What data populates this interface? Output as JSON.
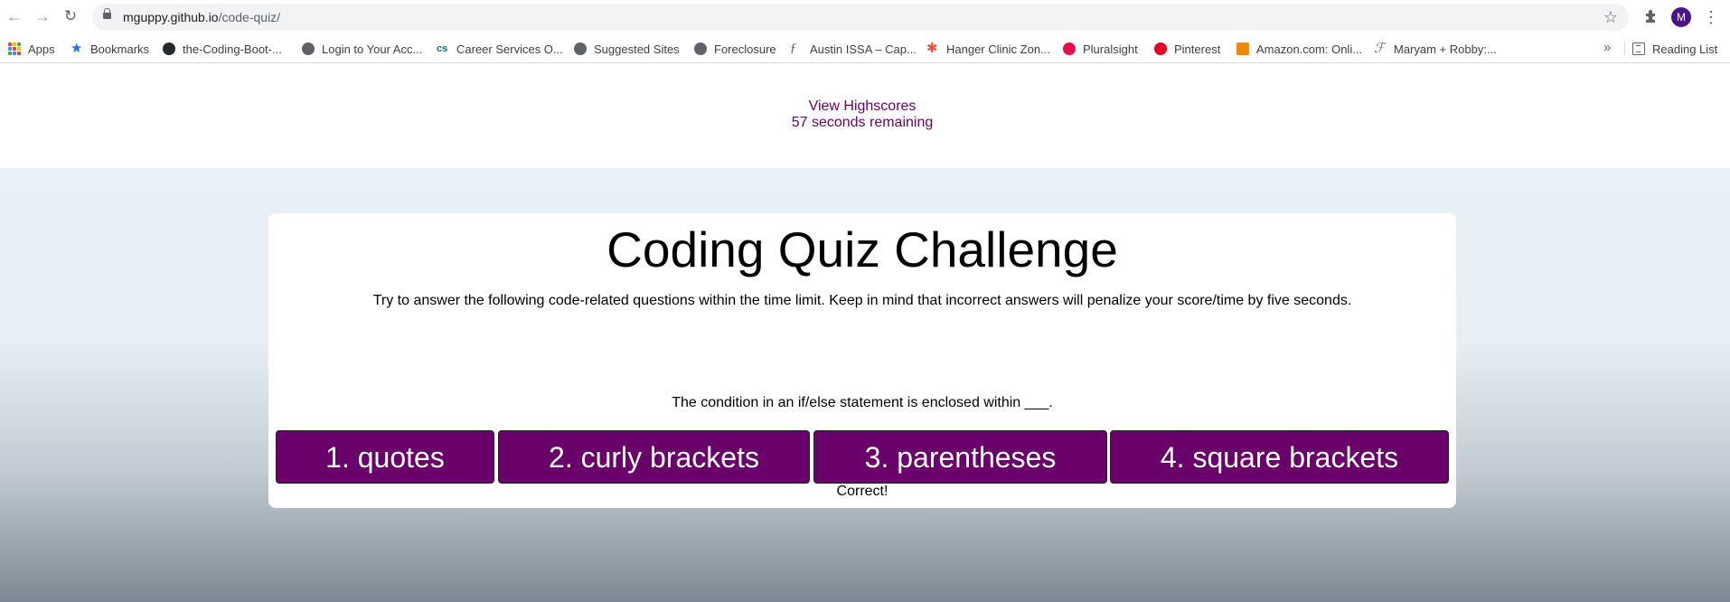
{
  "browser": {
    "url_host": "mguppy.github.io",
    "url_path": "/code-quiz/",
    "profile_initial": "M",
    "bookmarks": [
      {
        "label": "Apps",
        "icon": "apps-grid-icon"
      },
      {
        "label": "Bookmarks",
        "icon": "star-icon"
      },
      {
        "label": "the-Coding-Boot-...",
        "icon": "github-icon"
      },
      {
        "label": "Login to Your Acc...",
        "icon": "globe-icon"
      },
      {
        "label": "Career Services O...",
        "icon": "cs-icon"
      },
      {
        "label": "Suggested Sites",
        "icon": "globe-icon"
      },
      {
        "label": "Foreclosure",
        "icon": "globe-icon"
      },
      {
        "label": "Austin ISSA – Cap...",
        "icon": "issa-icon"
      },
      {
        "label": "Hanger Clinic Zon...",
        "icon": "hanger-icon"
      },
      {
        "label": "Pluralsight",
        "icon": "pluralsight-icon"
      },
      {
        "label": "Pinterest",
        "icon": "pinterest-icon"
      },
      {
        "label": "Amazon.com: Onli...",
        "icon": "amazon-icon"
      },
      {
        "label": "Maryam + Robby:...",
        "icon": "f-script-icon"
      }
    ],
    "reading_list": "Reading List"
  },
  "header": {
    "highscores": "View Highscores",
    "timer": "57 seconds remaining"
  },
  "quiz": {
    "title": "Coding Quiz Challenge",
    "intro": "Try to answer the following code-related questions within the time limit. Keep in mind that incorrect answers will penalize your score/time by five seconds.",
    "question": "The condition in an if/else statement is enclosed within ___.",
    "answers": [
      "1. quotes",
      "2. curly brackets",
      "3. parentheses",
      "4. square brackets"
    ],
    "feedback": "Correct!"
  },
  "colors": {
    "accent": "#6a006a"
  }
}
